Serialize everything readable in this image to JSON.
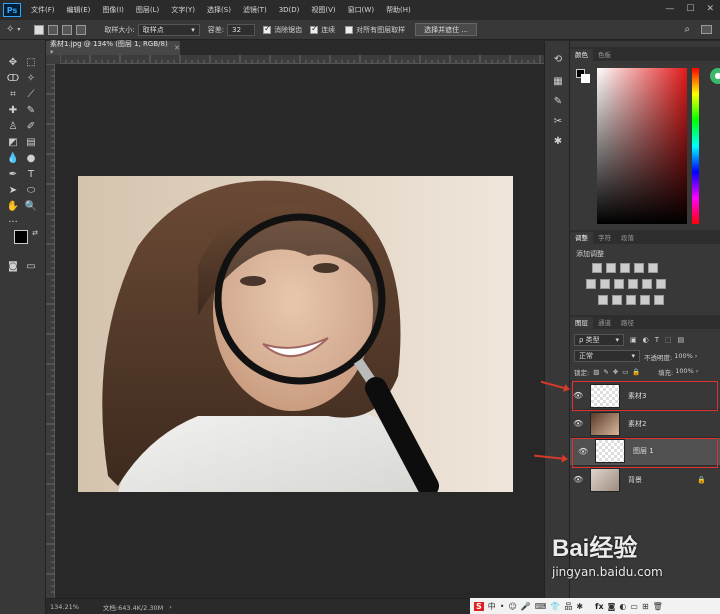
{
  "menubar": {
    "logo": "Ps",
    "items": [
      "文件(F)",
      "编辑(E)",
      "图像(I)",
      "图层(L)",
      "文字(Y)",
      "选择(S)",
      "滤镜(T)",
      "3D(D)",
      "视图(V)",
      "窗口(W)",
      "帮助(H)"
    ],
    "window_buttons": [
      "—",
      "☐",
      "✕"
    ]
  },
  "optionsbar": {
    "sample_size_label": "取样大小:",
    "sample_size_value": "取样点",
    "tolerance_label": "容差:",
    "tolerance_value": "32",
    "antialias_label": "消除锯齿",
    "contiguous_label": "连续",
    "sample_all_label": "对所有图层取样",
    "select_mask_button": "选择并遮住 ...",
    "search_icon": "search-icon"
  },
  "document": {
    "tab_title": "素材1.jpg @ 134% (图层 1, RGB/8) *",
    "zoom": "134.21%",
    "doc_info": "文档:643.4K/2.30M"
  },
  "color_panel": {
    "tabs": [
      "颜色",
      "色板"
    ]
  },
  "adjust_panel": {
    "tabs": [
      "调整",
      "字符",
      "段落"
    ],
    "title": "添加调整"
  },
  "layers_panel": {
    "tabs": [
      "图层",
      "通道",
      "路径"
    ],
    "filter_kind": "ρ 类型",
    "blend_mode": "正常",
    "opacity_label": "不透明度:",
    "opacity_value": "100%",
    "lock_label": "锁定:",
    "fill_label": "填充:",
    "fill_value": "100%",
    "layers": [
      {
        "name": "素材3",
        "selected": false
      },
      {
        "name": "素材2",
        "selected": false
      },
      {
        "name": "图层 1",
        "selected": true
      },
      {
        "name": "背景",
        "selected": false
      }
    ]
  },
  "watermark": {
    "brand": "Bai经验",
    "url": "jingyan.baidu.com"
  },
  "tray": {
    "items": [
      "中",
      "•",
      "☺",
      "🎤",
      "⌨",
      "👕",
      "品",
      "✱"
    ]
  },
  "colors": {
    "accent": "#31a8ff",
    "annotation_red": "#e03030"
  }
}
